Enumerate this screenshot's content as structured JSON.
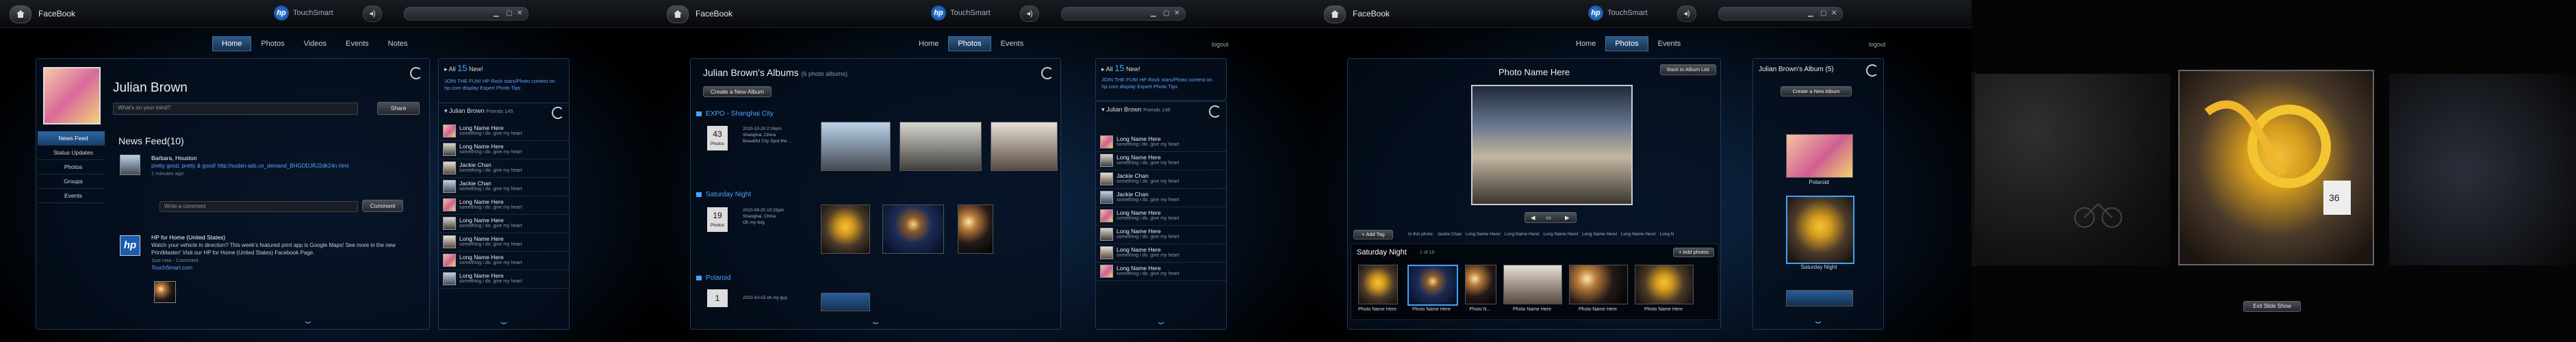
{
  "app": {
    "title": "FaceBook",
    "brand": "TouchSmart",
    "logo": "hp",
    "volume_icon": "speaker-icon"
  },
  "screen1": {
    "nav": [
      "Home",
      "Photos",
      "Videos",
      "Events",
      "Notes"
    ],
    "profile": {
      "name": "Julian Brown",
      "status_placeholder": "What's on your mind?",
      "share": "Share"
    },
    "left_nav": [
      "News Feed",
      "Status Updates",
      "Photos",
      "Groups",
      "Events"
    ],
    "news_feed": {
      "title": "News Feed(10)",
      "items": [
        {
          "name": "Barbara, Houston",
          "text": "pretty good, pretty & good! http://sudan-ads.cn_demand_BHGDDJRJ2dk24n.html",
          "time": "1 minutes ago"
        },
        {
          "name": "HP for Home (United States)",
          "text": "Watch your vehicle in direction? This week's featured print app is Google Maps! See more in the new PrintMaster! Visit our HP for Home (United States) Facebook Page.",
          "time": "Just now - Comment",
          "extra": "TouchSmart.com"
        }
      ],
      "comment_placeholder": "Write a comment",
      "comment_button": "Comment"
    },
    "notifications": {
      "label": "All",
      "count": "15",
      "suffix": "New!",
      "text": "JOIN THE FUN! HP Rock stars/Photo contest on hp.com display Expert Photo Tips"
    },
    "friends": {
      "title": "Julian Brown",
      "count": "Friends 145",
      "rows": [
        {
          "name": "Long Name Here",
          "sub": "something i do. give my heart"
        },
        {
          "name": "Long Name Here",
          "sub": "something i do. give my heart"
        },
        {
          "name": "Jackie Chan",
          "sub": "something i do. give my heart"
        },
        {
          "name": "Jackie Chan",
          "sub": "something i do. give my heart"
        },
        {
          "name": "Long Name Here",
          "sub": "something i do. give my heart"
        },
        {
          "name": "Long Name Here",
          "sub": "something i do. give my heart"
        },
        {
          "name": "Long Name Here",
          "sub": "something i do. give my heart"
        },
        {
          "name": "Long Name Here",
          "sub": "something i do. give my heart"
        },
        {
          "name": "Long Name Here",
          "sub": "something i do. give my heart"
        }
      ]
    }
  },
  "screen2": {
    "nav": [
      "Home",
      "Photos",
      "Events"
    ],
    "logout": "logout",
    "albums_title": "Julian Brown's Albums",
    "albums_count": "(6 photo albums)",
    "create_album": "Create a New Album",
    "albums": [
      {
        "name": "EXPO - Shanghai City",
        "count": "43",
        "unit": "Photos",
        "meta": "2010-10-20 2:24pm\nShanghai, China\nBeautiful City Spot the ..."
      },
      {
        "name": "Saturday Night",
        "count": "19",
        "unit": "Photos",
        "meta": "2010-09-20 10:15pm\nShanghai, China\nOh my dog"
      },
      {
        "name": "Polaroid",
        "count": "1",
        "unit": "",
        "meta": "2010-10-15 oh my guy"
      }
    ],
    "notifications": {
      "label": "All",
      "count": "15",
      "suffix": "New!",
      "text": "JOIN THE FUN! HP Rock stars/Photo contest on hp.com display Expert Photo Tips"
    },
    "friends": {
      "title": "Julian Brown",
      "count": "Friends 145",
      "rows": [
        {
          "name": "Long Name Here",
          "sub": "something i do. give my heart"
        },
        {
          "name": "Long Name Here",
          "sub": "something i do. give my heart"
        },
        {
          "name": "Jackie Chan",
          "sub": "something i do. give my heart"
        },
        {
          "name": "Jackie Chan",
          "sub": "something i do. give my heart"
        },
        {
          "name": "Long Name Here",
          "sub": "something i do. give my heart"
        },
        {
          "name": "Long Name Here",
          "sub": "something i do. give my heart"
        },
        {
          "name": "Long Name Here",
          "sub": "something i do. give my heart"
        },
        {
          "name": "Long Name Here",
          "sub": "something i do. give my heart"
        }
      ]
    }
  },
  "screen3": {
    "nav": [
      "Home",
      "Photos",
      "Events"
    ],
    "logout": "logout",
    "photo_name": "Photo Name Here",
    "back_button": "Back to Album List",
    "add_tag": "Add Tag",
    "tags": [
      "In this photo:",
      "Jackie Chan",
      "Long Name Here!",
      "Long Name Here!",
      "Long Name Here!",
      "Long Name Here!",
      "Long Name Here!",
      "Long N"
    ],
    "strip": {
      "title": "Saturday Night",
      "count": "1 of 19",
      "add_photos": "Add photos",
      "captions": [
        "Photo Name Here",
        "Photo Name Here",
        "Photo N...",
        "Photo Name Here",
        "Photo Name Here",
        "Photo Name Here"
      ]
    },
    "albums_panel": {
      "title": "Julian Brown's Album",
      "count": "(5)",
      "create": "Create a New Album",
      "albums": [
        "Polaroid",
        "Saturday Night"
      ]
    }
  },
  "screen4": {
    "exit": "Exit Slide Show"
  }
}
